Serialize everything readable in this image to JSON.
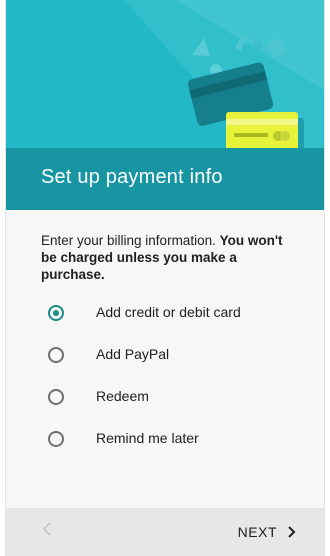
{
  "header": {
    "title": "Set up payment info"
  },
  "intro": {
    "text": "Enter your billing information. ",
    "bold_text": "You won't be charged unless you make a purchase."
  },
  "options": [
    {
      "label": "Add credit or debit card",
      "selected": true
    },
    {
      "label": "Add PayPal",
      "selected": false
    },
    {
      "label": "Redeem",
      "selected": false
    },
    {
      "label": "Remind me later",
      "selected": false
    }
  ],
  "nav": {
    "back_icon": "chevron-left-icon",
    "next_label": "NEXT",
    "next_icon": "chevron-right-icon"
  },
  "colors": {
    "hero_bg": "#22b8c6",
    "title_band": "#1895a3",
    "accent": "#1a8c85",
    "card_front": "#e7f23b"
  }
}
